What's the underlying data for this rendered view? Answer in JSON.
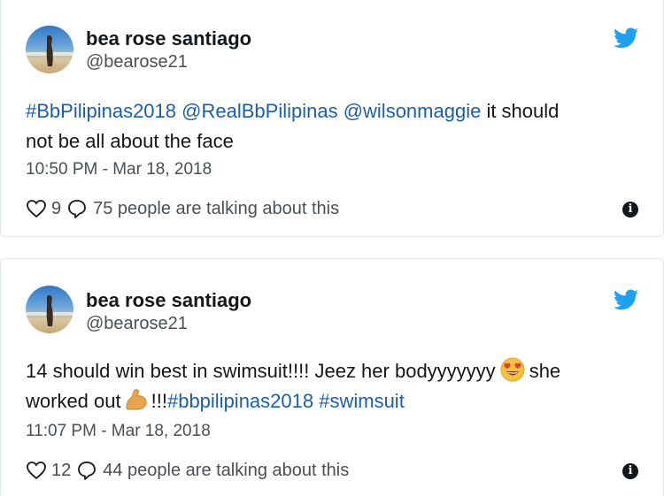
{
  "tweets": [
    {
      "name": "bea rose santiago",
      "handle": "@bearose21",
      "hashtag1": "#BbPilipinas2018",
      "mention1": "@RealBbPilipinas",
      "mention2": "@wilsonmaggie",
      "text_a": " it should",
      "text_b": "not be all about the face",
      "time": "10:50 PM - Mar 18, 2018",
      "likes": "9",
      "talk": "75 people are talking about this"
    },
    {
      "name": "bea rose santiago",
      "handle": "@bearose21",
      "text_a": "14 should win best in swimsuit!!!! Jeez her bodyyyyyyy",
      "text_b": "she",
      "text_c": "worked out",
      "text_d": "!!!",
      "hashtag1": "#bbpilipinas2018",
      "hashtag2": "#swimsuit",
      "time": "11:07 PM - Mar 18, 2018",
      "likes": "12",
      "talk": "44 people are talking about this"
    }
  ],
  "colors": {
    "link": "#1b5fa8",
    "twitter_blue": "#1da1f2",
    "text": "#14171a",
    "muted": "#4a4f55"
  },
  "icons": [
    "twitter-bird-icon",
    "heart-icon",
    "reply-bubble-icon",
    "info-icon",
    "heart-eyes-emoji",
    "flexed-biceps-emoji"
  ]
}
